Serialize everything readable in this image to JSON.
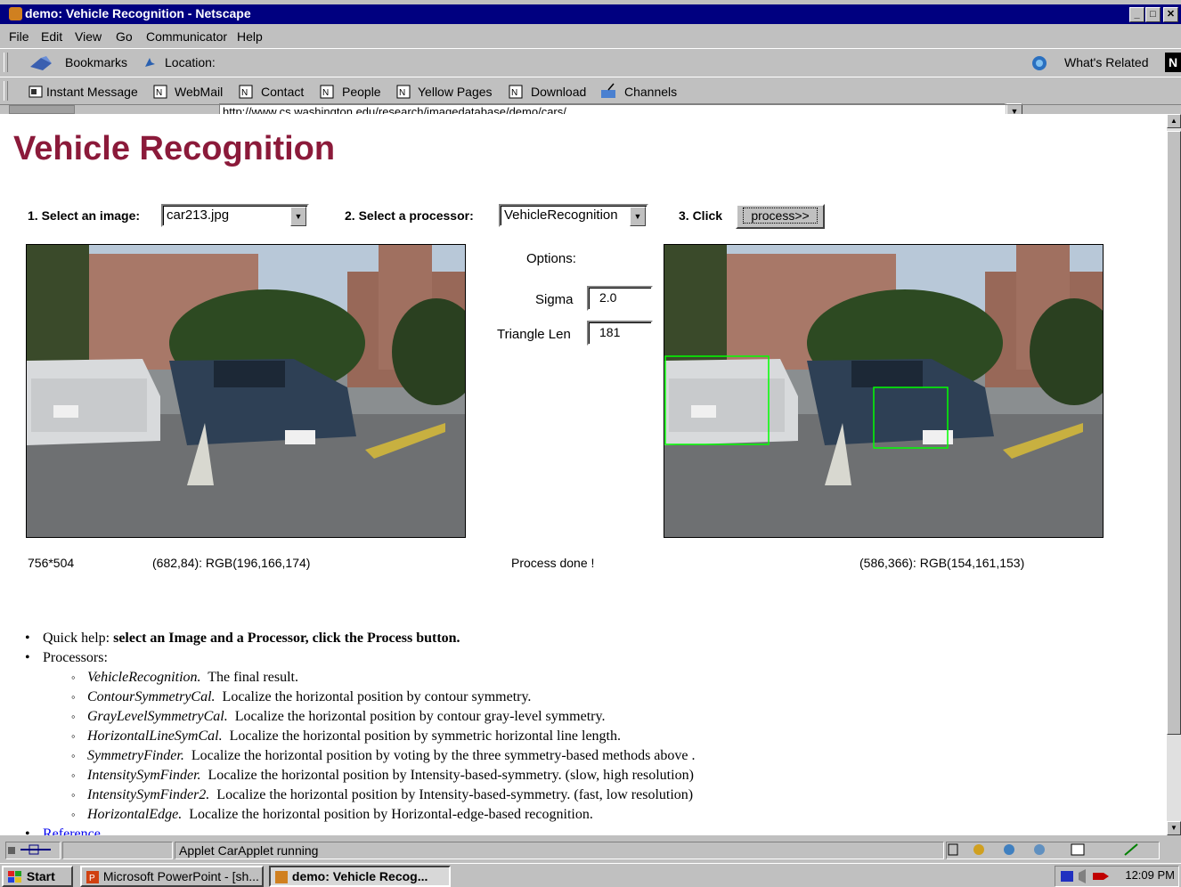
{
  "window": {
    "title": "demo: Vehicle Recognition - Netscape",
    "min": "_",
    "max": "□",
    "close": "✕"
  },
  "menu": [
    "File",
    "Edit",
    "View",
    "Go",
    "Communicator",
    "Help"
  ],
  "navbar": {
    "bookmarks": "Bookmarks",
    "location_label": "Location:",
    "url": "http://www.cs.washington.edu/research/imagedatabase/demo/cars/",
    "whats_related": "What's Related"
  },
  "personal": [
    "Instant Message",
    "WebMail",
    "Contact",
    "People",
    "Yellow Pages",
    "Download",
    "Channels"
  ],
  "page": {
    "heading": "Vehicle Recognition",
    "step1": "1. Select an image:",
    "image_select": "car213.jpg",
    "step2": "2. Select a processor:",
    "processor_select": "VehicleRecognition",
    "step3": "3. Click",
    "process_button": "process>>",
    "options_label": "Options:",
    "sigma_label": "Sigma",
    "sigma_value": "2.0",
    "triangle_label": "Triangle Len",
    "triangle_value": "181",
    "status_size": "756*504",
    "status_left_pixel": "(682,84): RGB(196,166,174)",
    "status_process": "Process done !",
    "status_right_pixel": "(586,366): RGB(154,161,153)"
  },
  "help": {
    "quick_label": "Quick help:",
    "quick_text": "select an Image and a Processor, click the Process button.",
    "processors_label": "Processors:",
    "processors": [
      {
        "name": "VehicleRecognition.",
        "desc": "The final result."
      },
      {
        "name": "ContourSymmetryCal.",
        "desc": "Localize the horizontal position by contour symmetry."
      },
      {
        "name": "GrayLevelSymmetryCal.",
        "desc": "Localize the horizontal position by contour gray-level symmetry."
      },
      {
        "name": "HorizontalLineSymCal.",
        "desc": "Localize the horizontal position by symmetric horizontal line length."
      },
      {
        "name": "SymmetryFinder.",
        "desc": "Localize the horizontal position by voting by the three symmetry-based methods above ."
      },
      {
        "name": "IntensitySymFinder.",
        "desc": "Localize the horizontal position by Intensity-based-symmetry. (slow, high resolution)"
      },
      {
        "name": "IntensitySymFinder2.",
        "desc": "Localize the horizontal position by Intensity-based-symmetry. (fast, low resolution)"
      },
      {
        "name": "HorizontalEdge.",
        "desc": "Localize the horizontal position by Horizontal-edge-based recognition."
      }
    ],
    "reference": "Reference"
  },
  "statusbar": {
    "text": "Applet CarApplet running"
  },
  "taskbar": {
    "start": "Start",
    "task1": "Microsoft PowerPoint - [sh...",
    "task2": "demo: Vehicle Recog...",
    "clock": "12:09 PM"
  },
  "colors": {
    "titlebar": "#000080",
    "heading": "#8b1a3a",
    "detection_box": "#00ff00",
    "link": "#0000ee"
  }
}
